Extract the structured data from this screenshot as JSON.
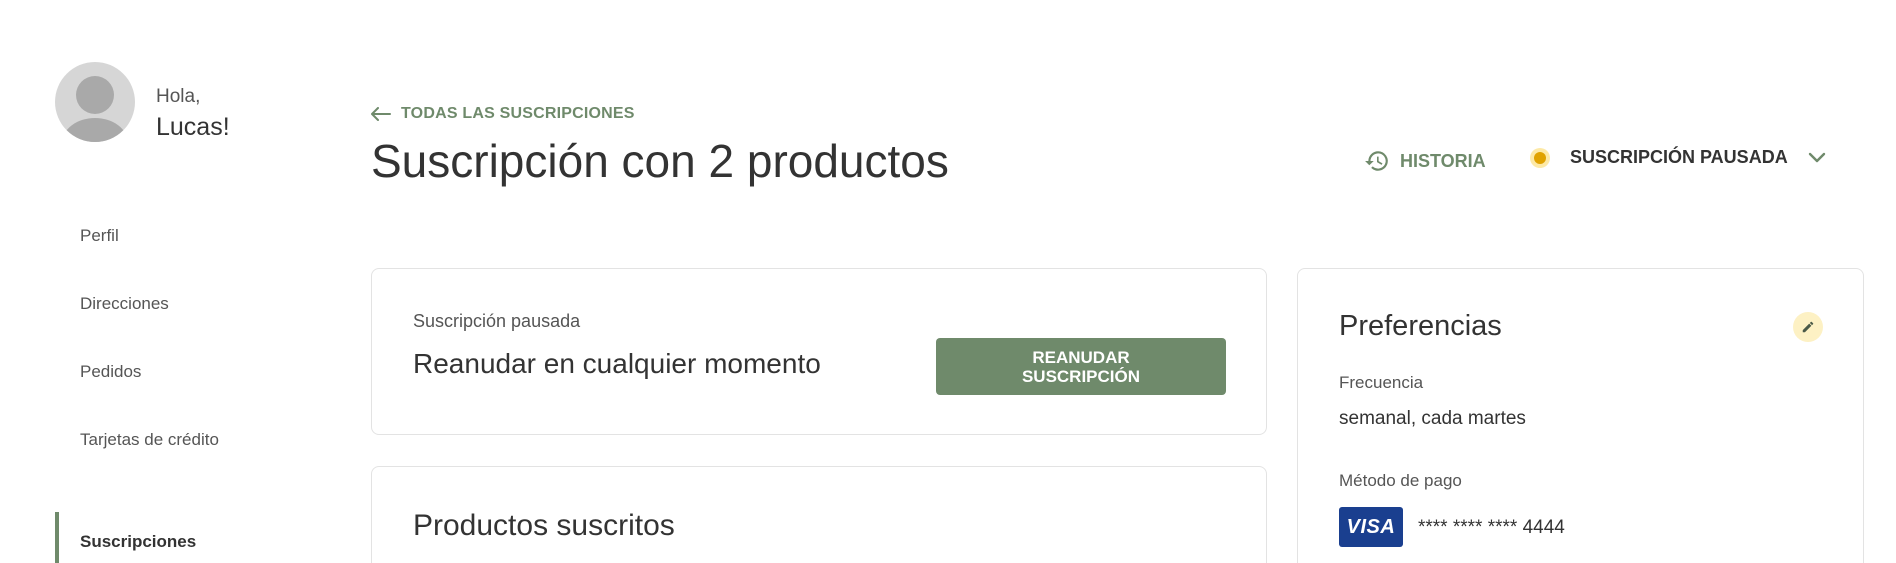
{
  "sidebar": {
    "greeting": "Hola,",
    "user_name": "Lucas!",
    "items": [
      {
        "label": "Perfil"
      },
      {
        "label": "Direcciones"
      },
      {
        "label": "Pedidos"
      },
      {
        "label": "Tarjetas de crédito"
      },
      {
        "label": "Suscripciones"
      }
    ],
    "active_item": "Suscripciones"
  },
  "header": {
    "back_label": "TODAS LAS SUSCRIPCIONES",
    "title": "Suscripción con 2 productos",
    "history_label": "HISTORIA",
    "status_label": "SUSCRIPCIÓN PAUSADA",
    "status_color": "#e0a200"
  },
  "paused_card": {
    "subtitle": "Suscripción pausada",
    "message": "Reanudar en cualquier momento",
    "resume_button": "REANUDAR\nSUSCRIPCIÓN"
  },
  "products_card": {
    "title": "Productos suscritos"
  },
  "preferences": {
    "title": "Preferencias",
    "frequency_label": "Frecuencia",
    "frequency_value": "semanal, cada martes",
    "payment_label": "Método de pago",
    "card_brand": "VISA",
    "card_number": "**** **** **** 4444"
  },
  "colors": {
    "accent": "#6f8a6b",
    "visa_blue": "#1a3f8f",
    "status_yellow": "#e0a200"
  },
  "icons": {
    "back": "arrow-left-icon",
    "history": "history-icon",
    "status": "status-dot-icon",
    "dropdown": "chevron-down-icon",
    "edit": "pencil-icon"
  }
}
